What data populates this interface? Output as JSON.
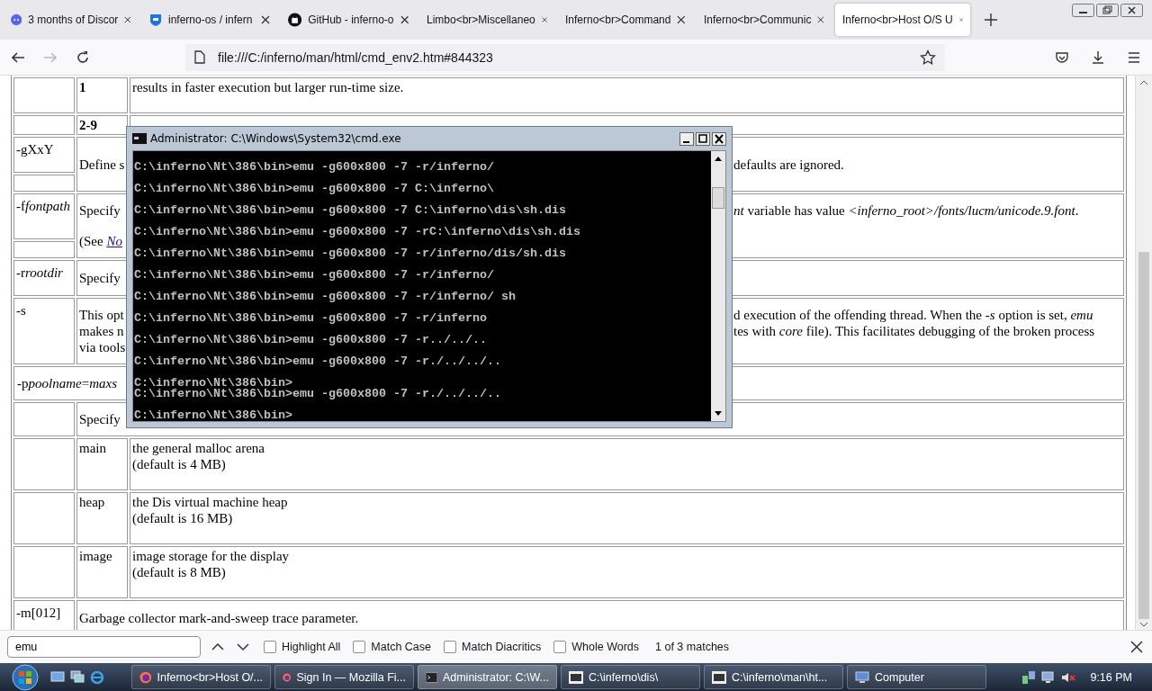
{
  "tabs": [
    {
      "label": "3 months of Discor",
      "kind": "discord",
      "selected": false
    },
    {
      "label": "inferno-os / infern",
      "kind": "shield",
      "selected": false
    },
    {
      "label": "GitHub - inferno-o",
      "kind": "github",
      "selected": false
    },
    {
      "label": "Limbo<br>Miscellaneo",
      "selected": false
    },
    {
      "label": "Inferno<br>Command",
      "selected": false
    },
    {
      "label": "Inferno<br>Communic",
      "selected": false
    },
    {
      "label": "Inferno<br>Host O/S U",
      "selected": true
    }
  ],
  "nav": {
    "buttons": [
      {
        "kind": "back",
        "disabled": false
      },
      {
        "kind": "forward",
        "disabled": true
      },
      {
        "kind": "reload",
        "disabled": false
      }
    ],
    "url": "file:///C:/inferno/man/html/cmd_env2.htm#844323"
  },
  "document": {
    "rows": [
      {
        "kind": "sub",
        "value": "1",
        "bold": true,
        "lines": [
          "results in faster execution but larger run-time size."
        ]
      },
      {
        "kind": "sub",
        "value": "2-9",
        "bold": true
      },
      {
        "kind": "option",
        "option": [
          {
            "text": "-gXxY",
            "italic": false
          }
        ],
        "blank_below": true,
        "left": [
          {
            "lines": [
              "Define s"
            ]
          }
        ],
        "right": [
          {
            "lines": [
              "defaults are ignored."
            ]
          }
        ]
      },
      {
        "kind": "option",
        "option": [
          {
            "text": "-f",
            "italic": false
          },
          {
            "text": "fontpath",
            "italic": true
          }
        ],
        "blank_below": true,
        "left": [
          {
            "lines": [
              "Specify"
            ]
          },
          {
            "lines": [
              "(See "
            ],
            "link": "No"
          }
        ],
        "right": [
          {
            "lines": [
              "*nt* variable has value *<inferno_root>/fonts/lucm/unicode.9.font*."
            ]
          }
        ]
      },
      {
        "kind": "option",
        "option": [
          {
            "text": "-r",
            "italic": false
          },
          {
            "text": "rootdir",
            "italic": true
          }
        ],
        "blank_below": false,
        "left": [
          {
            "lines": [
              "Specify"
            ]
          }
        ]
      },
      {
        "kind": "option",
        "option": [
          {
            "text": "-s",
            "italic": false
          }
        ],
        "blank_below": false,
        "left": [
          {
            "lines": [
              "This opt",
              "makes n",
              "via tools"
            ]
          }
        ],
        "right": [
          {
            "lines": [
              "d execution of the offending thread. When the *-s* option is set, *emu*",
              "tes with *core* file). This facilitates debugging of the broken process"
            ]
          }
        ]
      },
      {
        "kind": "wide",
        "option": [
          {
            "text": "-p",
            "italic": false
          },
          {
            "text": "poolname",
            "italic": true
          },
          {
            "text": "=",
            "italic": false
          },
          {
            "text": "maxs",
            "italic": true
          }
        ]
      },
      {
        "kind": "option",
        "blank_below": false,
        "left": [
          {
            "lines": [
              "Specify"
            ]
          }
        ]
      },
      {
        "kind": "sub",
        "value": "main",
        "bold": false,
        "lines": [
          "the general malloc arena",
          "(default is 4 MB)"
        ]
      },
      {
        "kind": "sub",
        "value": "heap",
        "bold": false,
        "lines": [
          "the Dis virtual machine heap",
          "(default is 16 MB)"
        ]
      },
      {
        "kind": "sub",
        "value": "image",
        "bold": false,
        "lines": [
          "image storage for the display",
          "(default is 8 MB)"
        ]
      },
      {
        "kind": "option",
        "option": [
          {
            "text": "-m[012]",
            "italic": false
          }
        ],
        "blank_below": false,
        "left": [
          {
            "lines": [
              "Garbage collector mark-and-sweep trace parameter."
            ]
          }
        ]
      }
    ]
  },
  "console": {
    "title": "Administrator: C:\\Windows\\System32\\cmd.exe",
    "lines": [
      {
        "text": "C:\\inferno\\Nt\\386\\bin>emu -g600x800 -7 -r/inferno/",
        "spaced": true
      },
      {
        "text": "C:\\inferno\\Nt\\386\\bin>emu -g600x800 -7 C:\\inferno\\",
        "spaced": true
      },
      {
        "text": "C:\\inferno\\Nt\\386\\bin>emu -g600x800 -7 C:\\inferno\\dis\\sh.dis",
        "spaced": true
      },
      {
        "text": "C:\\inferno\\Nt\\386\\bin>emu -g600x800 -7 -rC:\\inferno\\dis\\sh.dis",
        "spaced": true
      },
      {
        "text": "C:\\inferno\\Nt\\386\\bin>emu -g600x800 -7 -r/inferno/dis/sh.dis",
        "spaced": true
      },
      {
        "text": "C:\\inferno\\Nt\\386\\bin>emu -g600x800 -7 -r/inferno/",
        "spaced": true
      },
      {
        "text": "C:\\inferno\\Nt\\386\\bin>emu -g600x800 -7 -r/inferno/ sh",
        "spaced": true
      },
      {
        "text": "C:\\inferno\\Nt\\386\\bin>emu -g600x800 -7 -r/inferno",
        "spaced": true
      },
      {
        "text": "C:\\inferno\\Nt\\386\\bin>emu -g600x800 -7 -r../../..",
        "spaced": true
      },
      {
        "text": "C:\\inferno\\Nt\\386\\bin>emu -g600x800 -7 -r./../../..",
        "spaced": true
      },
      {
        "text": "C:\\inferno\\Nt\\386\\bin>",
        "spaced": true
      },
      {
        "text": "C:\\inferno\\Nt\\386\\bin>emu -g600x800 -7 -r./../../..",
        "spaced": false
      },
      {
        "text": "C:\\inferno\\Nt\\386\\bin>",
        "spaced": true
      }
    ]
  },
  "find": {
    "value": "emu",
    "options": [
      {
        "label": "Highlight All",
        "checked": false
      },
      {
        "label": "Match Case",
        "checked": false
      },
      {
        "label": "Match Diacritics",
        "checked": false
      },
      {
        "label": "Whole Words",
        "checked": false
      }
    ],
    "status": "1 of 3 matches"
  },
  "taskbar": {
    "tasks": [
      {
        "label": "Inferno<br>Host O/...",
        "kind": "browser",
        "selected": false
      },
      {
        "label": "Sign In — Mozilla Fi...",
        "kind": "browser",
        "selected": false
      },
      {
        "label": "Administrator: C:\\W...",
        "kind": "console",
        "selected": true
      },
      {
        "label": "C:\\inferno\\dis\\",
        "kind": "archive",
        "selected": false
      },
      {
        "label": "C:\\inferno\\man\\ht...",
        "kind": "archive",
        "selected": false
      },
      {
        "label": "Computer",
        "kind": "computer",
        "selected": false
      }
    ],
    "time": "9:16 PM"
  }
}
